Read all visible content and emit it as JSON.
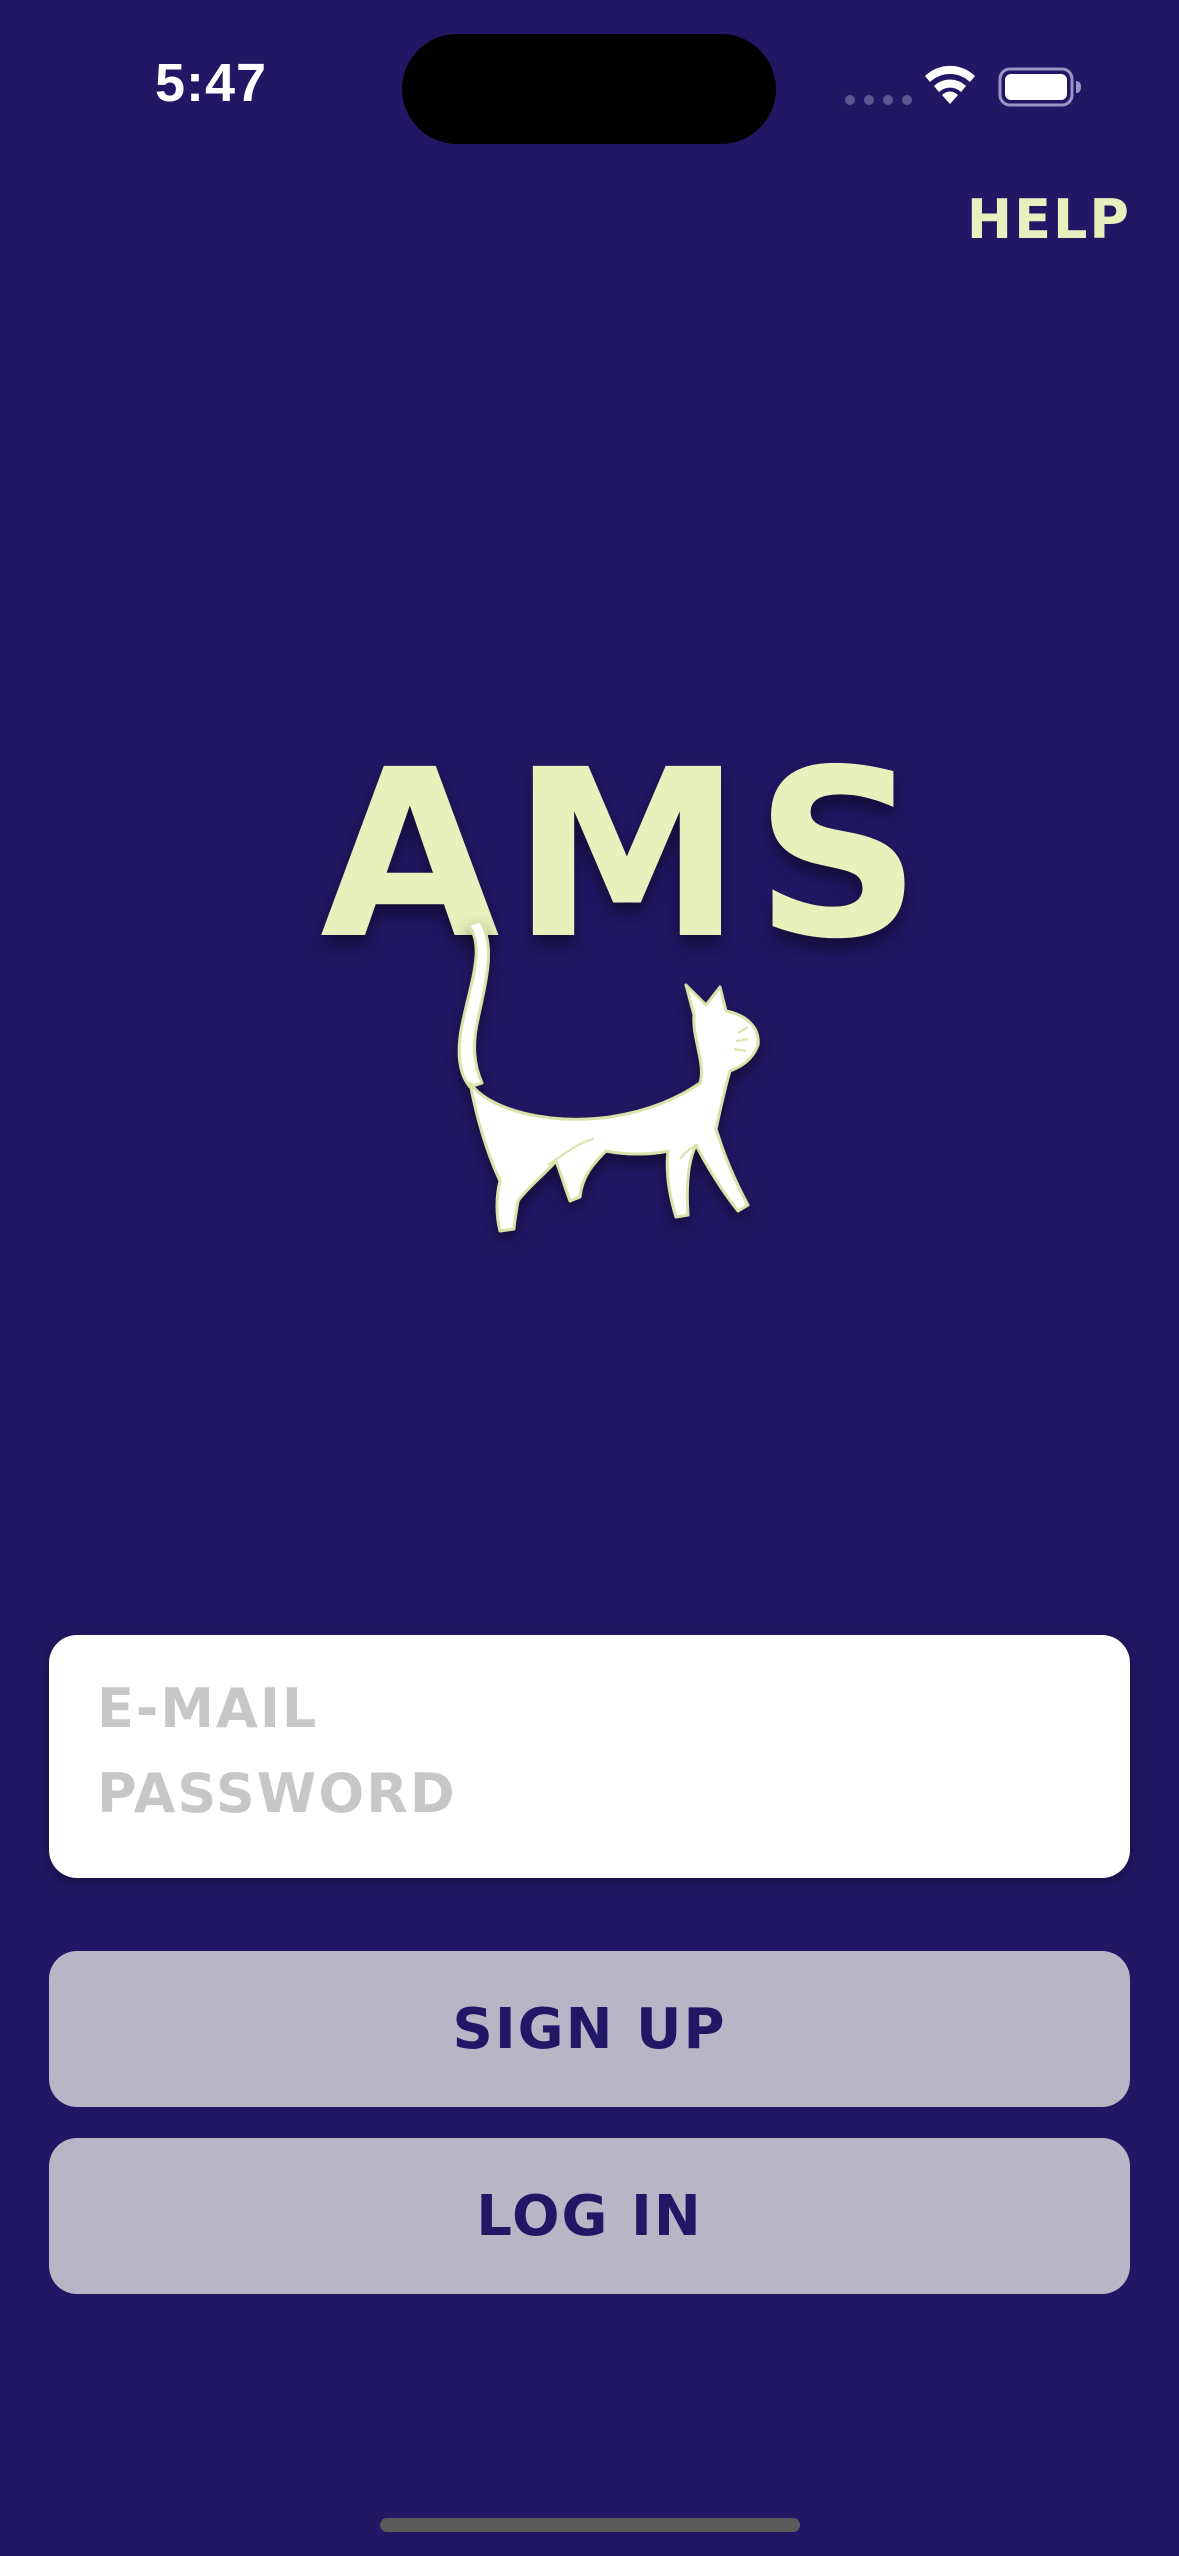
{
  "status_bar": {
    "time": "5:47"
  },
  "help": {
    "label": "HELP"
  },
  "logo": {
    "text": "AMS",
    "icon": "cat-icon"
  },
  "login": {
    "email_placeholder": "E-MAIL",
    "email_value": "",
    "password_placeholder": "PASSWORD",
    "password_value": ""
  },
  "buttons": {
    "signup_label": "SIGN UP",
    "login_label": "LOG IN"
  },
  "colors": {
    "background": "#211764",
    "accent": "#e8f0bc",
    "button_bg": "#b7b5c6",
    "button_text": "#211764"
  }
}
